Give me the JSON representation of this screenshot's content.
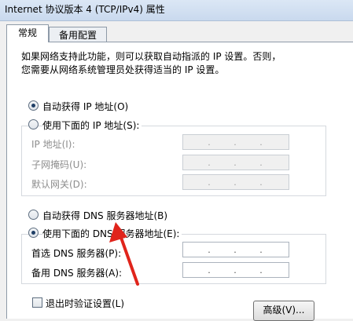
{
  "window": {
    "title": "Internet 协议版本 4 (TCP/IPv4) 属性"
  },
  "tabs": [
    {
      "label": "常规",
      "active": true
    },
    {
      "label": "备用配置",
      "active": false
    }
  ],
  "description": {
    "line1": "如果网络支持此功能，则可以获取自动指派的 IP 设置。否则，",
    "line2": "您需要从网络系统管理员处获得适当的 IP 设置。"
  },
  "ip": {
    "auto_label": "自动获得 IP 地址(O)",
    "auto_selected": true,
    "manual_label": "使用下面的 IP 地址(S):",
    "manual_selected": false,
    "fields": [
      {
        "label": "IP 地址(I):"
      },
      {
        "label": "子网掩码(U):"
      },
      {
        "label": "默认网关(D):"
      }
    ]
  },
  "dns": {
    "auto_label": "自动获得 DNS 服务器地址(B)",
    "auto_selected": false,
    "manual_label": "使用下面的 DNS 服务器地址(E):",
    "manual_selected": true,
    "fields": [
      {
        "label": "首选 DNS 服务器(P):"
      },
      {
        "label": "备用 DNS 服务器(A):"
      }
    ]
  },
  "validate": {
    "label": "退出时验证设置(L)",
    "checked": false
  },
  "advanced_button": {
    "label": "高级(V)..."
  },
  "colors": {
    "arrow": "#e0241b",
    "panel_bg": "#ffffff",
    "dialog_bg": "#f0f0f0"
  }
}
